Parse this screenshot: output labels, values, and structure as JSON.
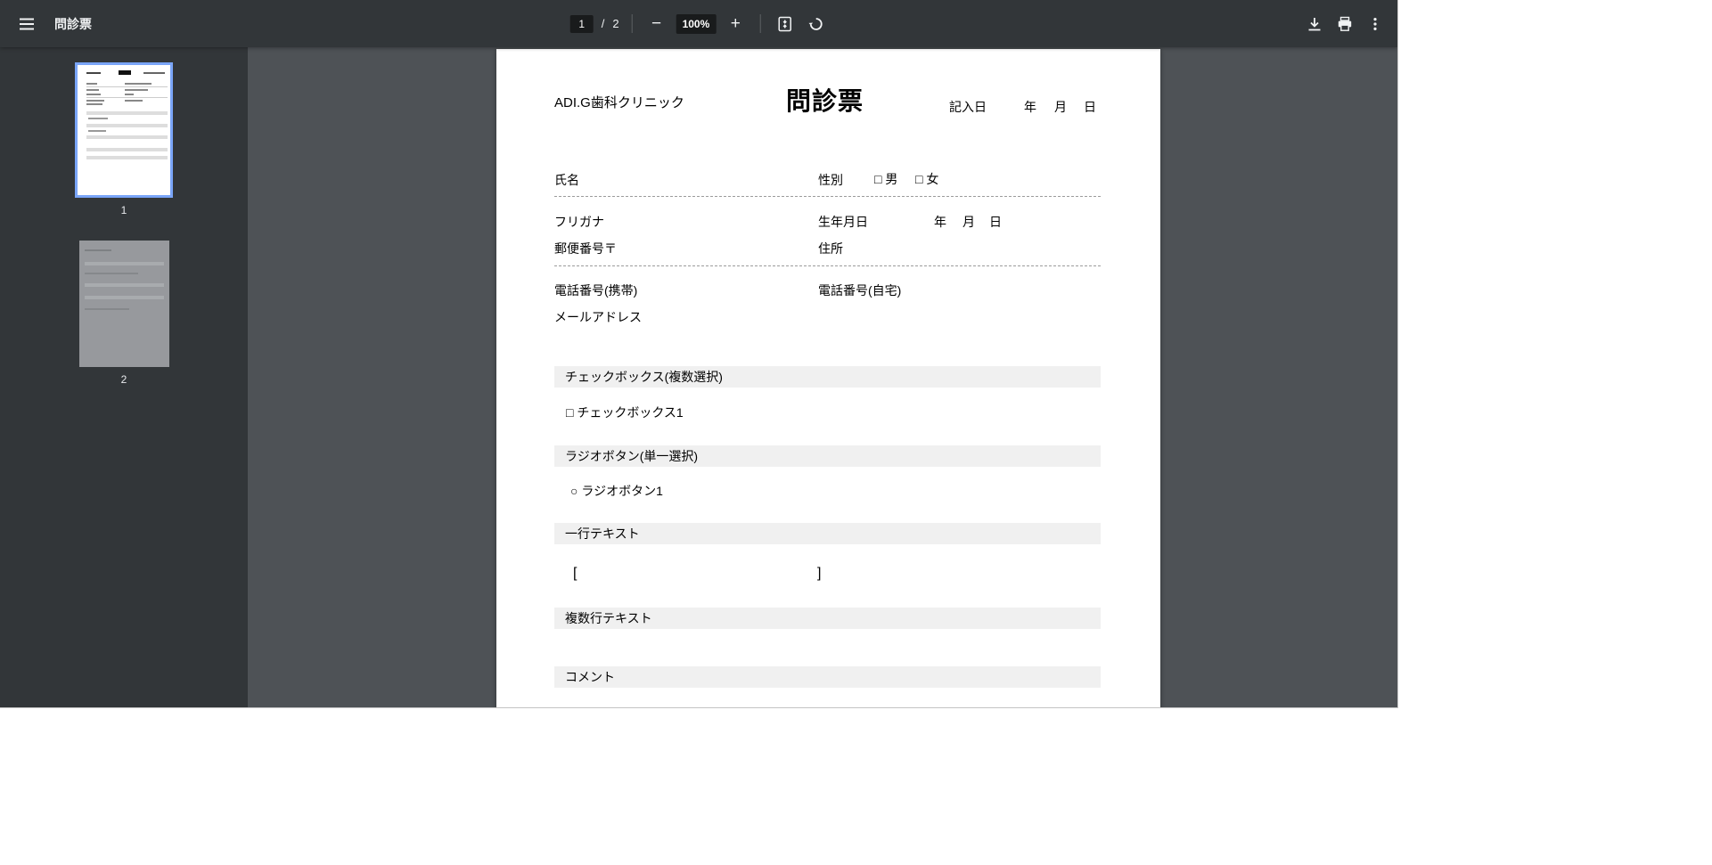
{
  "toolbar": {
    "title": "問診票",
    "page": {
      "current": "1",
      "separator": "/",
      "total": "2"
    },
    "zoom": {
      "out_glyph": "−",
      "level": "100%",
      "in_glyph": "+"
    }
  },
  "icons": {
    "menu": "hamburger-menu",
    "fit_page": "fit-to-page",
    "rotate": "rotate-counterclockwise",
    "download": "download",
    "print": "print",
    "more": "kebab-vertical-dots"
  },
  "sidebar": {
    "thumbnails": [
      {
        "label": "1"
      },
      {
        "label": "2"
      }
    ]
  },
  "doc": {
    "clinic": "ADI.G歯科クリニック",
    "title": "問診票",
    "entry_date": {
      "label": "記入日",
      "year": "年",
      "month": "月",
      "day": "日"
    },
    "fields": {
      "name": "氏名",
      "gender": "性別",
      "gender_male": "□ 男",
      "gender_female": "□ 女",
      "furigana": "フリガナ",
      "birth": "生年月日",
      "birth_year": "年",
      "birth_month": "月",
      "birth_day": "日",
      "postal": "郵便番号〒",
      "address": "住所",
      "phone_mobile": "電話番号(携帯)",
      "phone_home": "電話番号(自宅)",
      "email": "メールアドレス"
    },
    "sections": [
      {
        "header": "チェックボックス(複数選択)",
        "item": "□ チェックボックス1"
      },
      {
        "header": "ラジオボタン(単一選択)",
        "item": "○ ラジオボタン1"
      },
      {
        "header": "一行テキスト",
        "bracket_open": "[",
        "bracket_close": "]"
      },
      {
        "header": "複数行テキスト"
      },
      {
        "header": "コメント"
      }
    ]
  },
  "colors": {
    "toolbar_bg": "#323639",
    "viewer_bg": "#4e5256",
    "selected_thumb_border": "#7aa5f8",
    "section_bar_bg": "#f0f0f0"
  }
}
